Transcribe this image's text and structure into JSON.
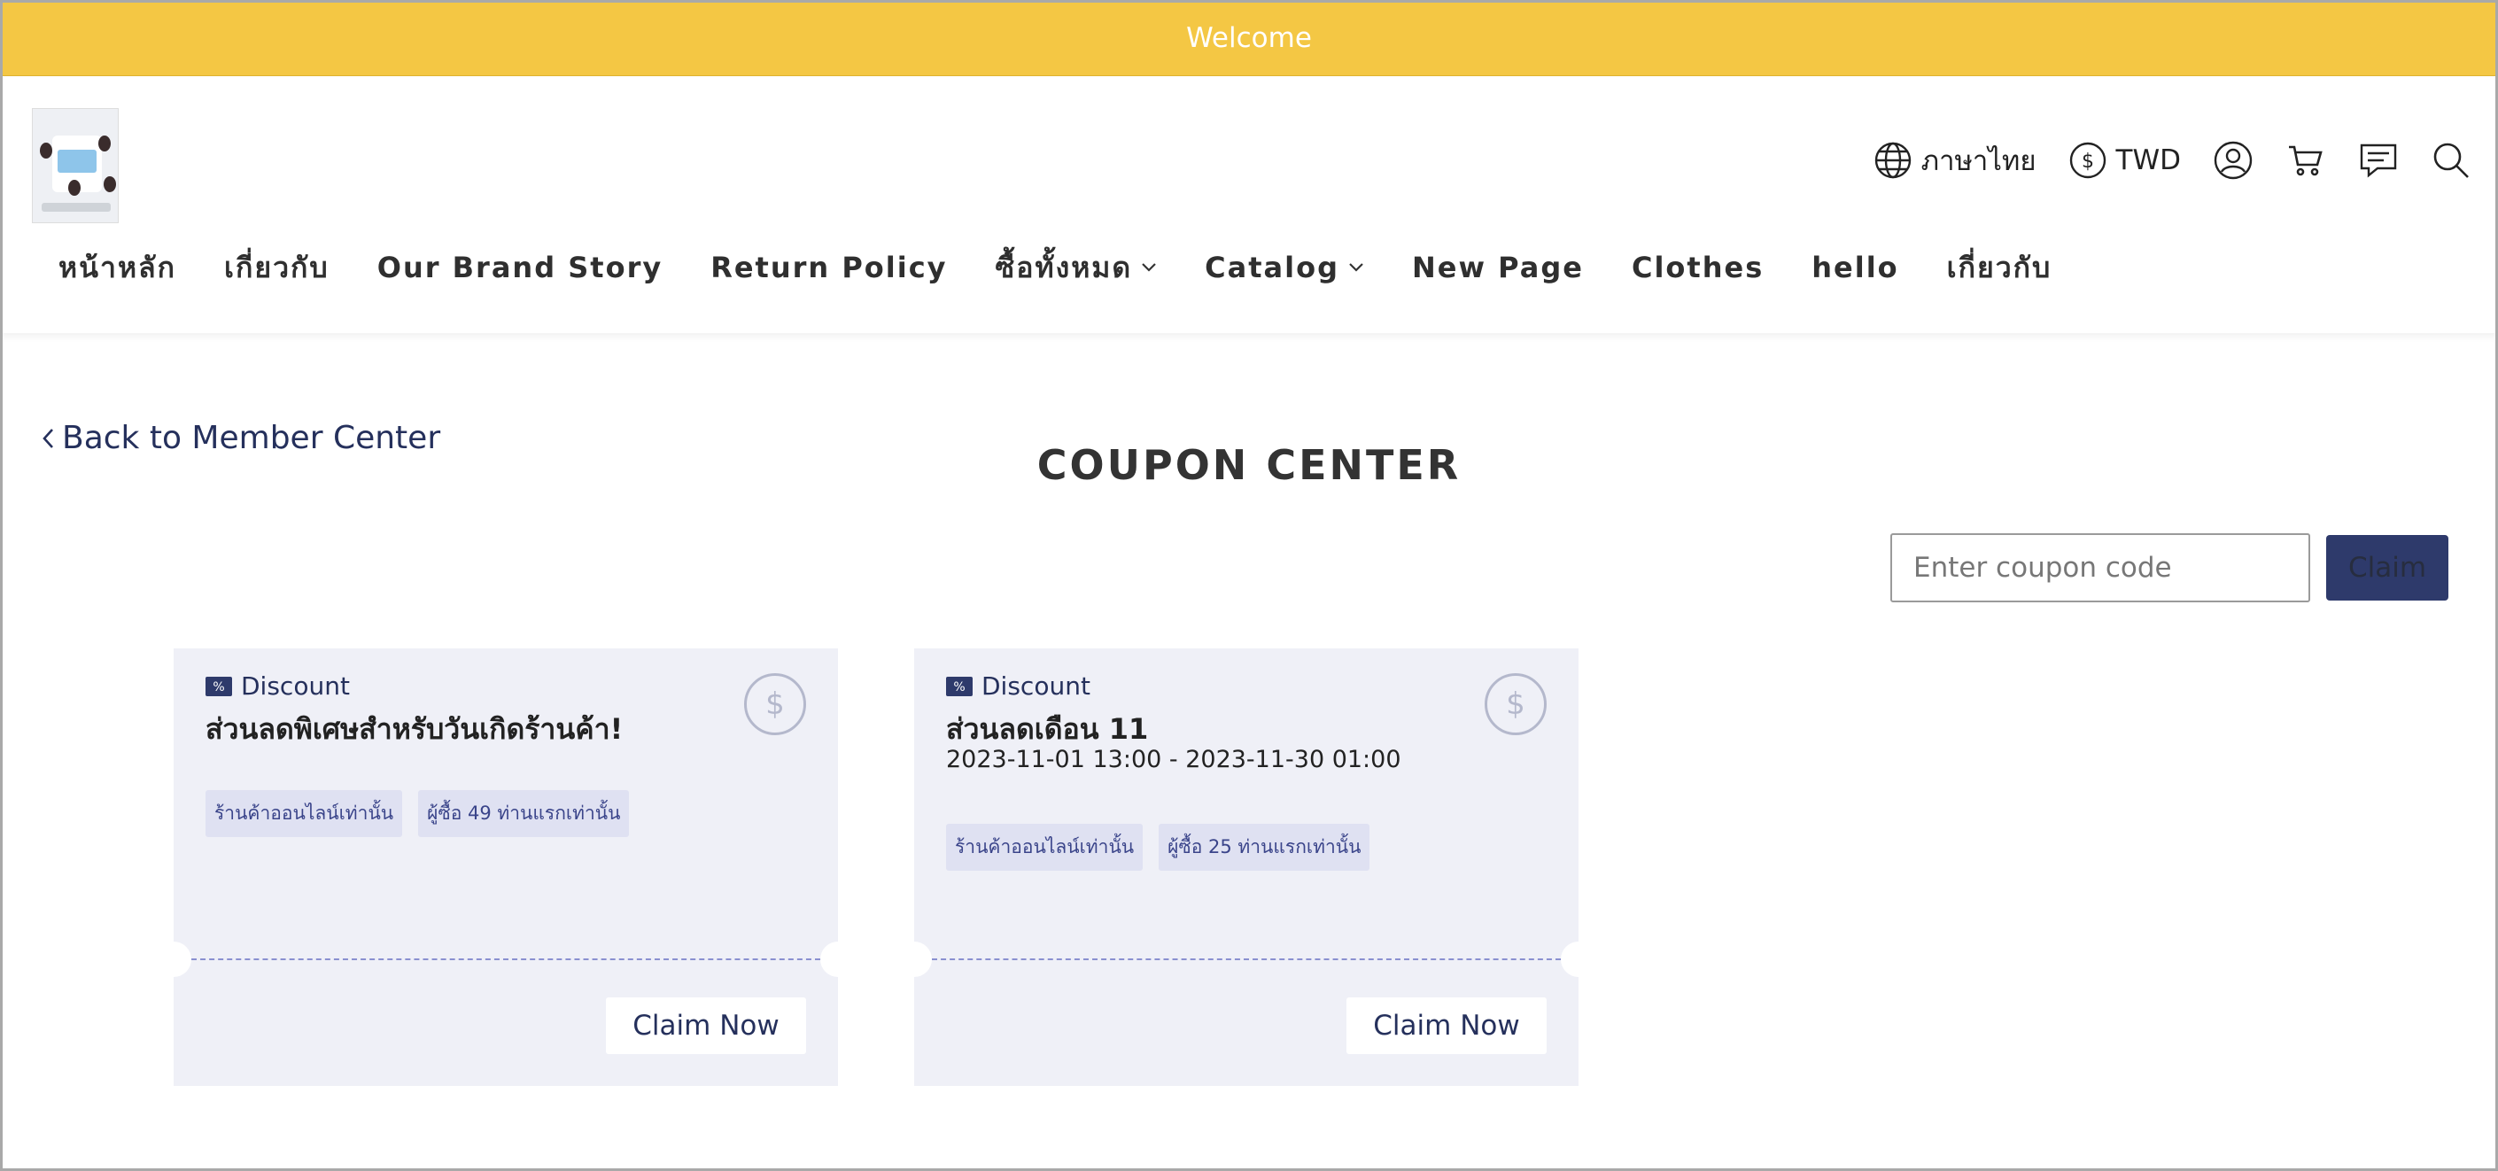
{
  "announcement": {
    "text": "Welcome"
  },
  "header": {
    "logo_alt": "Store logo",
    "language": "ภาษาไทย",
    "currency": "TWD",
    "icons": [
      "globe-icon",
      "currency-icon",
      "user-icon",
      "cart-icon",
      "message-icon",
      "search-icon"
    ]
  },
  "nav": {
    "items": [
      {
        "label": "หน้าหลัก"
      },
      {
        "label": "เกี่ยวกับ"
      },
      {
        "label": "Our Brand Story"
      },
      {
        "label": "Return Policy"
      },
      {
        "label": "ซื้อทั้งหมด",
        "dropdown": true
      },
      {
        "label": "Catalog",
        "dropdown": true
      },
      {
        "label": "New Page"
      },
      {
        "label": "Clothes"
      },
      {
        "label": "hello"
      },
      {
        "label": "เกี่ยวกับ"
      }
    ]
  },
  "main": {
    "back_label": "Back to Member Center",
    "title": "COUPON CENTER",
    "coupon_input_placeholder": "Enter coupon code",
    "claim_label": "Claim",
    "coupons": [
      {
        "type_label": "Discount",
        "title": "ส่วนลดพิเศษสำหรับวันเกิดร้านค้า!",
        "period": "",
        "tags": [
          "ร้านค้าออนไลน์เท่านั้น",
          "ผู้ซื้อ 49 ท่านแรกเท่านั้น"
        ],
        "button": "Claim Now"
      },
      {
        "type_label": "Discount",
        "title": "ส่วนลดเดือน 11",
        "period": "2023-11-01 13:00 - 2023-11-30 01:00",
        "tags": [
          "ร้านค้าออนไลน์เท่านั้น",
          "ผู้ซื้อ 25 ท่านแรกเท่านั้น"
        ],
        "button": "Claim Now"
      }
    ]
  },
  "colors": {
    "announcement_bg": "#f4c744",
    "primary": "#2e3a6b",
    "card_bg": "#eff0f7",
    "tag_bg": "#dfe1f2"
  }
}
